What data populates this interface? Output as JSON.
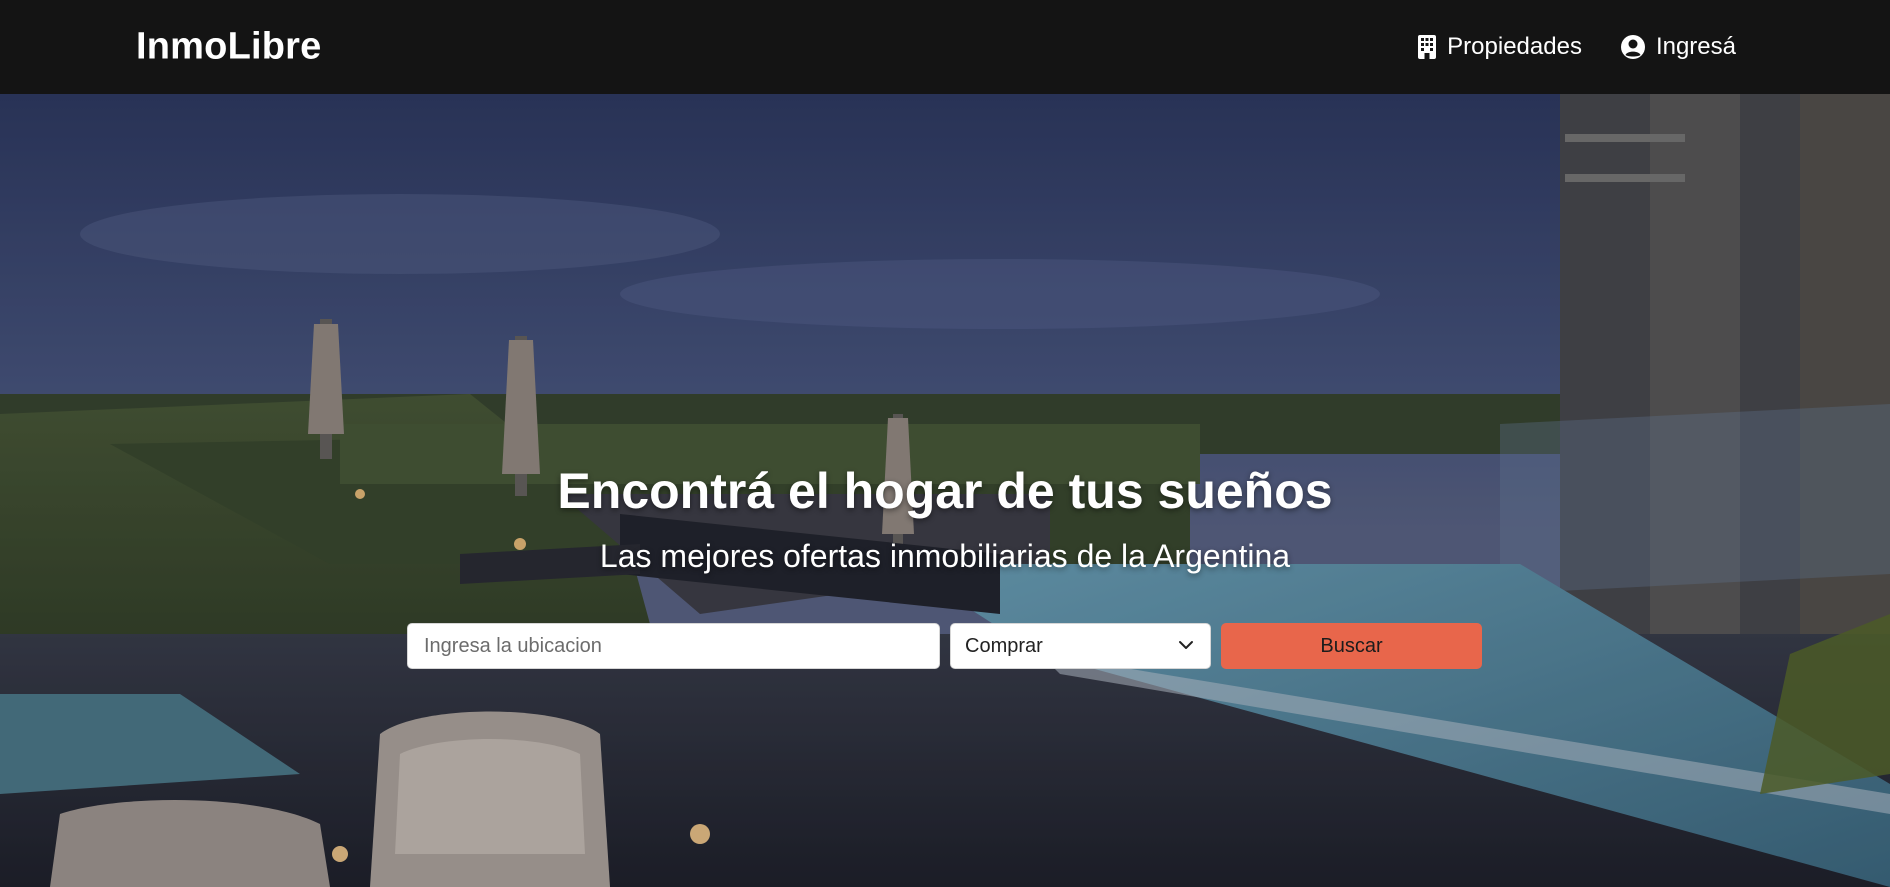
{
  "navbar": {
    "brand": "InmoLibre",
    "links": [
      {
        "label": "Propiedades",
        "icon": "building-icon"
      },
      {
        "label": "Ingresá",
        "icon": "user-circle-icon"
      }
    ]
  },
  "hero": {
    "title": "Encontrá el hogar de tus sueños",
    "subtitle": "Las mejores ofertas inmobiliarias de la Argentina",
    "background": "night rooftop pool terrace photo"
  },
  "search": {
    "location_placeholder": "Ingresa la ubicacion",
    "location_value": "",
    "operation_selected": "Comprar",
    "button_label": "Buscar"
  },
  "colors": {
    "navbar_bg": "#141414",
    "accent": "#e8664b",
    "text_light": "#ffffff"
  }
}
